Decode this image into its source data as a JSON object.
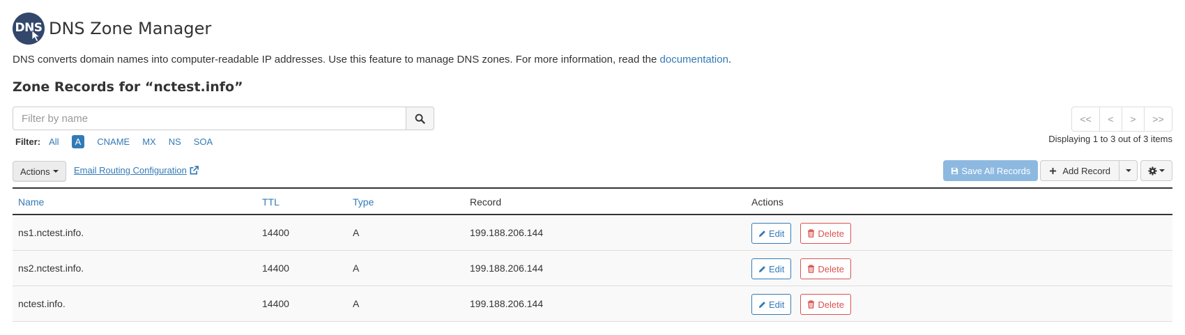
{
  "header": {
    "logo_text": "DNS",
    "title": "DNS Zone Manager"
  },
  "description": {
    "text": "DNS converts domain names into computer-readable IP addresses. Use this feature to manage DNS zones. For more information, read the ",
    "link": "documentation",
    "suffix": "."
  },
  "zone_heading": "Zone Records for “nctest.info”",
  "search": {
    "placeholder": "Filter by name",
    "value": ""
  },
  "filter": {
    "label": "Filter:",
    "items": [
      "All",
      "A",
      "CNAME",
      "MX",
      "NS",
      "SOA"
    ],
    "active": "A"
  },
  "pagination": {
    "first": "<<",
    "prev": "<",
    "next": ">",
    "last": ">>",
    "summary": "Displaying 1 to 3 out of 3 items"
  },
  "toolbar": {
    "actions_label": "Actions",
    "email_routing_label": "Email Routing Configuration",
    "save_all_label": "Save All Records",
    "add_record_label": "Add Record"
  },
  "table": {
    "headers": {
      "name": "Name",
      "ttl": "TTL",
      "type": "Type",
      "record": "Record",
      "actions": "Actions"
    },
    "rows": [
      {
        "name": "ns1.nctest.info.",
        "ttl": "14400",
        "type": "A",
        "record": "199.188.206.144"
      },
      {
        "name": "ns2.nctest.info.",
        "ttl": "14400",
        "type": "A",
        "record": "199.188.206.144"
      },
      {
        "name": "nctest.info.",
        "ttl": "14400",
        "type": "A",
        "record": "199.188.206.144"
      }
    ],
    "edit_label": "Edit",
    "delete_label": "Delete"
  },
  "colors": {
    "link": "#337ab7",
    "danger": "#d9534f",
    "primary_disabled": "#8db9e0",
    "logo_bg": "#33466b"
  },
  "icons": {
    "search": "search-icon",
    "external_link": "external-link-icon",
    "save": "save-icon",
    "add": "plus-icon",
    "settings": "gear-icon",
    "edit": "pencil-icon",
    "delete": "trash-icon"
  }
}
